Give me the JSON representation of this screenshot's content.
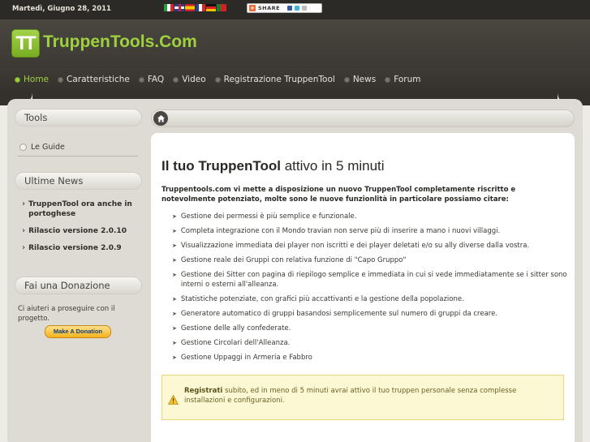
{
  "topbar": {
    "date": "Martedì, Giugno 28, 2011",
    "share_label": "SHARE"
  },
  "header": {
    "logo_mark": "TT",
    "logo_text": "TruppenTools.Com"
  },
  "nav": {
    "items": [
      {
        "label": "Home"
      },
      {
        "label": "Caratteristiche"
      },
      {
        "label": "FAQ"
      },
      {
        "label": "Video"
      },
      {
        "label": "Registrazione TruppenTool"
      },
      {
        "label": "News"
      },
      {
        "label": "Forum"
      }
    ]
  },
  "sidebar": {
    "tools_title": "Tools",
    "guide_label": "Le Guide",
    "news_title": "Ultime News",
    "news": [
      {
        "label": "TruppenTool ora anche in portoghese"
      },
      {
        "label": "Rilascio versione 2.0.10"
      },
      {
        "label": "Rilascio versione 2.0.9"
      }
    ],
    "donation_title": "Fai una Donazione",
    "donation_text": "Ci aiuteri a proseguire con il progetto.",
    "donation_button": "Make A Donation"
  },
  "content": {
    "title_bold": "Il tuo TruppenTool",
    "title_rest": " attivo in 5 minuti",
    "intro": "Truppentools.com vi mette a disposizione un nuovo TruppenTool completamente riscritto e notevolmente potenziato, molte sono le nuove funzionlità in particolare possiamo citare:",
    "features": [
      "Gestione dei permessi è più semplice e funzionale.",
      "Completa integrazione con il Mondo travian non serve più di inserire a mano i nuovi villaggi.",
      "Visualizzazione immediata dei player non iscritti e dei player deletati e/o su ally diverse dalla vostra.",
      "Gestione reale dei Gruppi con relativa funzione di \"Capo Gruppo\"",
      "Gestione dei Sitter con pagina di riepilogo semplice e immediata in cui si vede immediatamente se i sitter sono interni o esterni all'alleanza.",
      "Statistiche potenziate, con grafici più accattivanti e la gestione della popolazione.",
      "Generatore automatico di gruppi basandosi semplicemente sul numero di gruppi da creare.",
      "Gestione delle ally confederate.",
      "Gestione Circolari dell'Alleanza.",
      "Gestione Uppaggi in Armeria e Fabbro"
    ],
    "notice_bold": "Registrati",
    "notice_rest": " subito, ed in meno di 5 minuti avrai attivo il tuo truppen personale senza complesse installazioni e configurazioni."
  },
  "colors": {
    "accent_green": "#9fd13e",
    "dark_header": "#3c3934",
    "notice_bg": "#fdf8d4"
  }
}
